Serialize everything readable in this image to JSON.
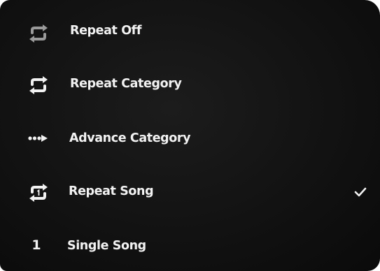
{
  "repeat_menu": {
    "items": [
      {
        "label": "Repeat Off",
        "icon": "repeat-off-icon",
        "selected": false
      },
      {
        "label": "Repeat Category",
        "icon": "repeat-icon",
        "selected": false
      },
      {
        "label": "Advance Category",
        "icon": "advance-icon",
        "selected": false
      },
      {
        "label": "Repeat Song",
        "icon": "repeat-one-icon",
        "selected": true
      },
      {
        "label": "Single Song",
        "icon": "single-number",
        "icon_text": "1",
        "selected": false
      }
    ]
  },
  "colors": {
    "background": "#121212",
    "text": "#f2f2f2",
    "icon_dim": "#9a9a9a",
    "icon": "#f2f2f2"
  }
}
